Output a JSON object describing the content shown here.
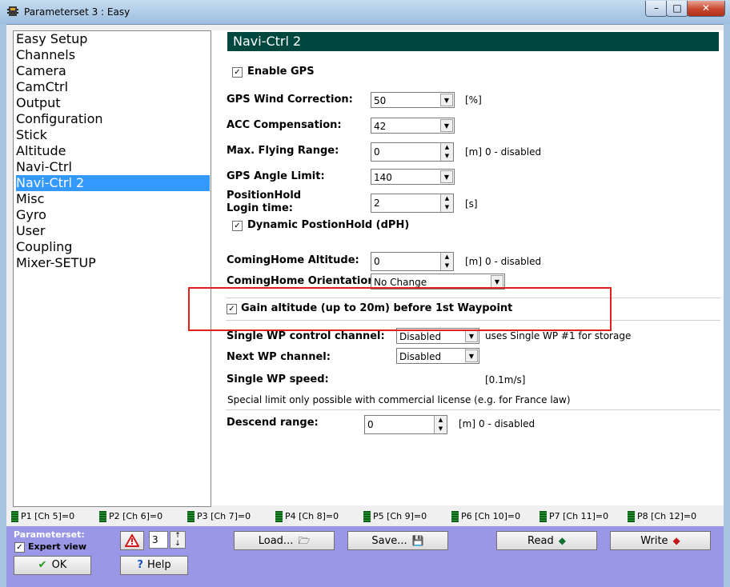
{
  "window": {
    "title": "Parameterset 3 : Easy",
    "minimize": "–",
    "maximize": "□",
    "close": "✕"
  },
  "nav": {
    "items": [
      {
        "label": "Easy Setup"
      },
      {
        "label": "Channels"
      },
      {
        "label": "Camera"
      },
      {
        "label": "CamCtrl"
      },
      {
        "label": "Output"
      },
      {
        "label": "Configuration"
      },
      {
        "label": "Stick"
      },
      {
        "label": "Altitude"
      },
      {
        "label": "Navi-Ctrl"
      },
      {
        "label": "Navi-Ctrl 2",
        "selected": true
      },
      {
        "label": "Misc"
      },
      {
        "label": "Gyro"
      },
      {
        "label": "User"
      },
      {
        "label": "Coupling"
      },
      {
        "label": "Mixer-SETUP"
      }
    ]
  },
  "section": {
    "title": "Navi-Ctrl 2",
    "enable_gps": {
      "label": "Enable GPS",
      "checked": true
    },
    "gps_wind": {
      "label": "GPS Wind Correction:",
      "value": "50",
      "unit": "[%]"
    },
    "acc_comp": {
      "label": "ACC Compensation:",
      "value": "42"
    },
    "max_range": {
      "label": "Max. Flying Range:",
      "value": "0",
      "unit": "[m]",
      "note": "0 - disabled"
    },
    "gps_angle": {
      "label": "GPS Angle Limit:",
      "value": "140"
    },
    "poshold_login": {
      "label_line1": "PositionHold",
      "label_line2": "Login time:",
      "value": "2",
      "unit": "[s]"
    },
    "dynamic_ph": {
      "label": "Dynamic PostionHold (dPH)",
      "checked": true
    },
    "coming_home_alt": {
      "label": "ComingHome Altitude:",
      "value": "0",
      "unit": "[m]",
      "note": "0 - disabled"
    },
    "coming_home_orient": {
      "label": "ComingHome Orientation:",
      "value": "No Change"
    },
    "gain_alt": {
      "label": "Gain altitude (up to 20m) before 1st Waypoint",
      "checked": true
    },
    "single_wp_channel": {
      "label": "Single WP control channel:",
      "value": "Disabled",
      "note": "uses Single WP #1 for storage"
    },
    "next_wp_channel": {
      "label": "Next WP channel:",
      "value": "Disabled"
    },
    "single_wp_speed": {
      "label": "Single WP speed:",
      "unit": "[0.1m/s]"
    },
    "license_note": "Special limit only possible with commercial license (e.g. for France law)",
    "descend_range": {
      "label": "Descend range:",
      "value": "0",
      "unit": "[m]",
      "note": "0 - disabled"
    }
  },
  "channels": [
    "P1 [Ch 5]=0",
    "P2 [Ch 6]=0",
    "P3 [Ch 7]=0",
    "P4 [Ch 8]=0",
    "P5 [Ch 9]=0",
    "P6 [Ch 10]=0",
    "P7 [Ch 11]=0",
    "P8 [Ch 12]=0"
  ],
  "bottom": {
    "parameterset_label": "Parameterset:",
    "expert_view": {
      "label": "Expert view",
      "checked": true
    },
    "ok": "OK",
    "help": "Help",
    "parameterset_number": "3",
    "load": "Load...",
    "save": "Save...",
    "read": "Read",
    "write": "Write"
  },
  "colors": {
    "section_header": "#00473f",
    "selection": "#3399ff",
    "bottom_panel": "#9a98e6",
    "highlight": "#e0201a"
  }
}
